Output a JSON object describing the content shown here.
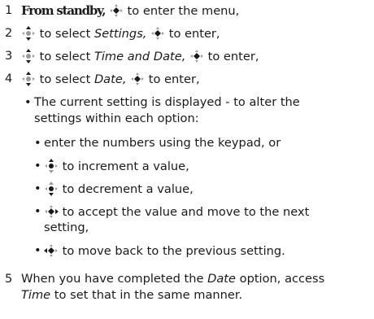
{
  "steps": [
    {
      "num": "1",
      "lead": "From standby,",
      "after_icon": " to enter the menu,"
    },
    {
      "num": "2",
      "pre": " to select ",
      "item": "Settings,",
      "post": " to enter,"
    },
    {
      "num": "3",
      "pre": " to select ",
      "item": "Time and Date,",
      "post": " to enter,"
    },
    {
      "num": "4",
      "pre": " to select ",
      "item": "Date,",
      "post": " to enter,"
    }
  ],
  "intro_bullet": {
    "line1": "The current setting is displayed - to alter the",
    "line2": "settings within each option:"
  },
  "sub_bullets": [
    {
      "text": "enter the numbers using the keypad, or"
    },
    {
      "text": " to increment a value,"
    },
    {
      "text": " to decrement a value,"
    },
    {
      "line1": " to accept the value and move to the next",
      "line2": "setting,"
    },
    {
      "text": " to move back to the previous setting."
    }
  ],
  "step5": {
    "num": "5",
    "l1_pre": "When you have completed the ",
    "l1_item": "Date",
    "l1_post": " option, access",
    "l2_item": "Time",
    "l2_post": " to set that in the same manner."
  },
  "icons": {
    "nav_key": "nav-key-icon",
    "color": "#1a1a1a",
    "light": "#9a9a9a"
  }
}
